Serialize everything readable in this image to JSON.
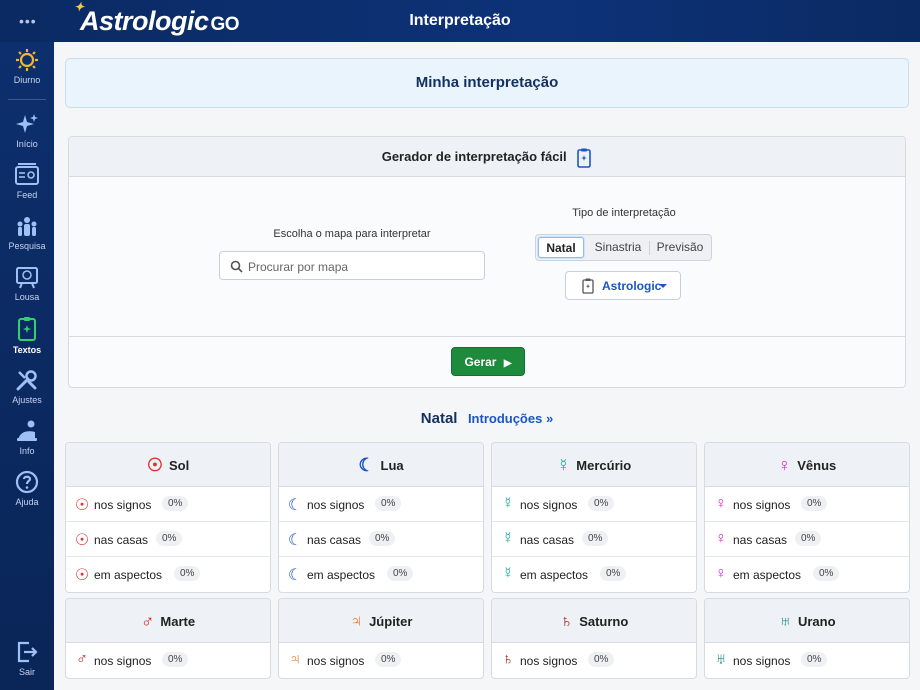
{
  "header": {
    "menu_dots": "•••",
    "logo_main": "Astrologic",
    "logo_suffix": "GO",
    "page_title": "Interpretação"
  },
  "sidebar": {
    "items": [
      {
        "label": "Diurno",
        "icon": "sun-icon"
      },
      {
        "label": "Início",
        "icon": "sparkles-icon"
      },
      {
        "label": "Feed",
        "icon": "feed-icon"
      },
      {
        "label": "Pesquisa",
        "icon": "people-search-icon"
      },
      {
        "label": "Lousa",
        "icon": "board-icon"
      },
      {
        "label": "Textos",
        "icon": "texts-icon",
        "active": true
      },
      {
        "label": "Ajustes",
        "icon": "tools-icon"
      },
      {
        "label": "Info",
        "icon": "info-person-icon"
      },
      {
        "label": "Ajuda",
        "icon": "help-icon"
      }
    ],
    "logout_label": "Sair"
  },
  "main": {
    "title": "Minha interpretação",
    "generator": {
      "title": "Gerador de interpretação fácil",
      "map_label": "Escolha o mapa para interpretar",
      "search_placeholder": "Procurar por mapa",
      "type_label": "Tipo de interpretação",
      "types": [
        "Natal",
        "Sinastria",
        "Previsão"
      ],
      "selected_type": "Natal",
      "source": "Astrologic",
      "generate_label": "Gerar"
    },
    "section_title": "Natal",
    "section_link": "Introduções »"
  },
  "planets": [
    {
      "name": "Sol",
      "symbol": "☉",
      "color": "#e03131",
      "rows": [
        {
          "label": "nos signos",
          "pct": "0%"
        },
        {
          "label": "nas casas",
          "pct": "0%"
        },
        {
          "label": "em aspectos",
          "pct": "0%"
        }
      ]
    },
    {
      "name": "Lua",
      "symbol": "☾",
      "color": "#1c4fc4",
      "rows": [
        {
          "label": "nos signos",
          "pct": "0%"
        },
        {
          "label": "nas casas",
          "pct": "0%"
        },
        {
          "label": "em aspectos",
          "pct": "0%"
        }
      ]
    },
    {
      "name": "Mercúrio",
      "symbol": "☿",
      "color": "#1aa39a",
      "rows": [
        {
          "label": "nos signos",
          "pct": "0%"
        },
        {
          "label": "nas casas",
          "pct": "0%"
        },
        {
          "label": "em aspectos",
          "pct": "0%"
        }
      ]
    },
    {
      "name": "Vênus",
      "symbol": "♀",
      "color": "#d62ec9",
      "rows": [
        {
          "label": "nos signos",
          "pct": "0%"
        },
        {
          "label": "nas casas",
          "pct": "0%"
        },
        {
          "label": "em aspectos",
          "pct": "0%"
        }
      ]
    },
    {
      "name": "Marte",
      "symbol": "♂",
      "color": "#d0231f",
      "rows": [
        {
          "label": "nos signos",
          "pct": "0%"
        }
      ]
    },
    {
      "name": "Júpiter",
      "symbol": "♃",
      "color": "#e8742b",
      "rows": [
        {
          "label": "nos signos",
          "pct": "0%"
        }
      ]
    },
    {
      "name": "Saturno",
      "symbol": "♄",
      "color": "#a3241d",
      "rows": [
        {
          "label": "nos signos",
          "pct": "0%"
        }
      ]
    },
    {
      "name": "Urano",
      "symbol": "♅",
      "color": "#1a8c88",
      "rows": [
        {
          "label": "nos signos",
          "pct": "0%"
        }
      ]
    }
  ]
}
